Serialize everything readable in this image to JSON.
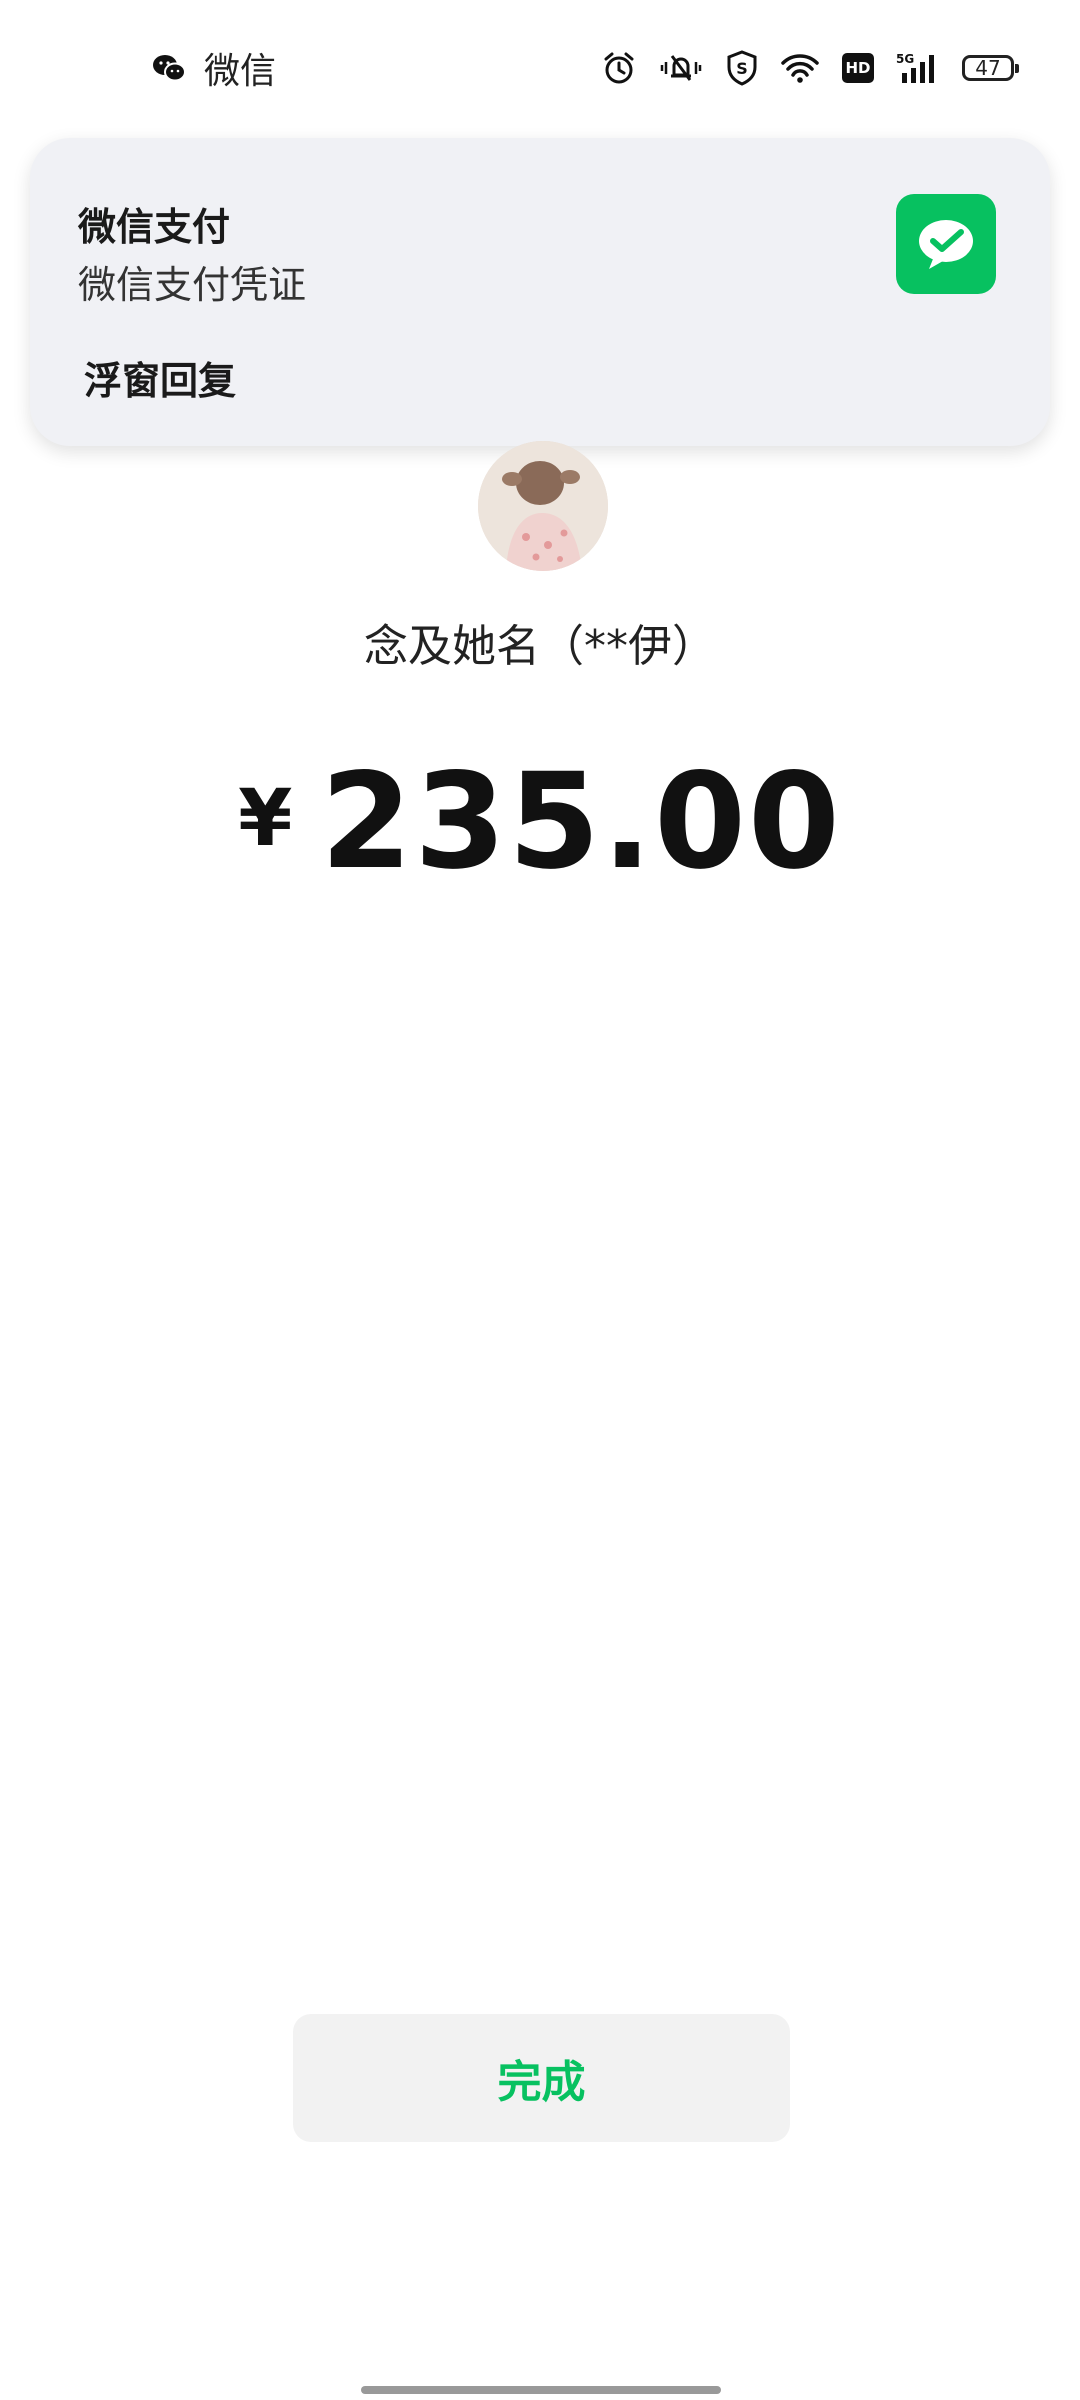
{
  "status_bar": {
    "app_name": "微信",
    "app_icon": "wechat-icon",
    "icons": [
      "alarm-icon",
      "mute-icon",
      "shield-icon",
      "wifi-icon",
      "hd-icon",
      "signal-5g-icon"
    ],
    "hd_label": "HD",
    "network_label": "5G",
    "battery_level": "47"
  },
  "notification": {
    "title": "微信支付",
    "body": "微信支付凭证",
    "action_label": "浮窗回复",
    "icon": "wechat-pay-icon"
  },
  "payment": {
    "payee": "念及她名（**伊）",
    "currency_symbol": "¥",
    "amount": "235.00"
  },
  "done_button": {
    "label": "完成"
  },
  "colors": {
    "accent": "#07c160",
    "button_bg": "#f2f2f2",
    "notification_bg": "#f0f1f5"
  }
}
